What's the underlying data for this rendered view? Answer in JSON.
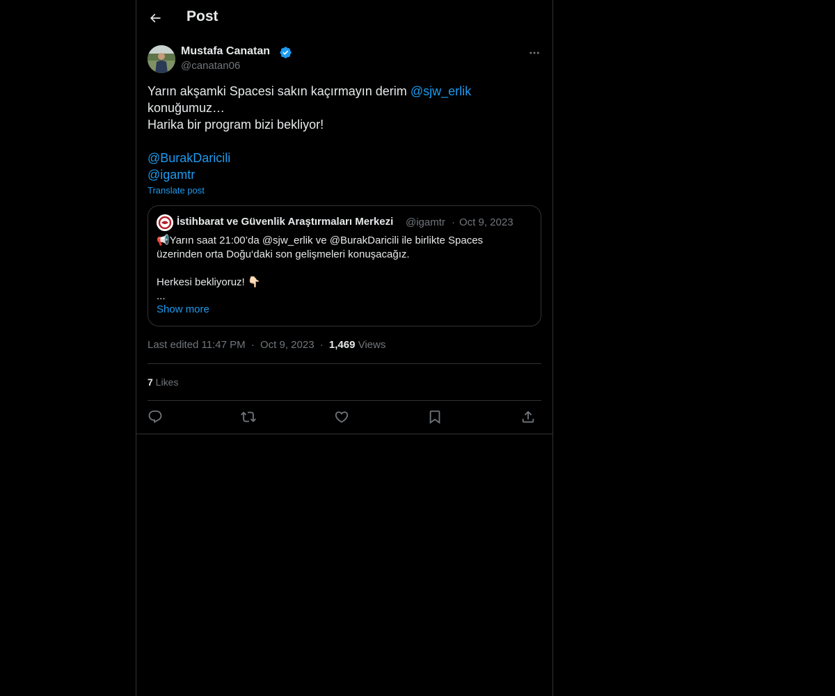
{
  "header": {
    "title": "Post",
    "back_icon": "arrow-left-icon"
  },
  "post": {
    "author": {
      "name": "Mustafa Canatan",
      "handle": "@canatan06",
      "verified_icon": "verified-badge-icon"
    },
    "more_icon": "more-horizontal-icon",
    "text": {
      "line1_prefix": "Yarın akşamki Spacesi sakın kaçırmayın derim ",
      "line1_mention": "@sjw_erlik",
      "line2": "konuğumuz…",
      "line3": "Harika bir program bizi bekliyor!",
      "mention2": "@BurakDaricili",
      "mention3": "@igamtr"
    },
    "translate_label": "Translate post",
    "quote": {
      "name": "İstihbarat ve Güvenlik Araştırmaları Merkezi",
      "handle": "@igamtr",
      "separator": "·",
      "date": "Oct 9, 2023",
      "line1": "📢Yarın saat 21:00’da @sjw_erlik ve @BurakDaricili  ile birlikte Spaces",
      "line2": "üzerinden orta Doğu‘daki son gelişmeleri konuşacağız.",
      "line3": "Herkesi bekliyoruz! 👇🏻",
      "ellipsis": "...",
      "show_more": "Show more"
    },
    "meta": {
      "edited": "Last edited 11:47 PM",
      "sep1": "·",
      "date": "Oct 9, 2023",
      "sep2": "·",
      "views_count": "1,469",
      "views_label": " Views"
    },
    "likes": {
      "count": "7",
      "label": " Likes"
    },
    "actions": [
      {
        "name": "reply",
        "icon": "reply-icon"
      },
      {
        "name": "repost",
        "icon": "repost-icon"
      },
      {
        "name": "like",
        "icon": "heart-icon"
      },
      {
        "name": "bookmark",
        "icon": "bookmark-icon"
      },
      {
        "name": "share",
        "icon": "share-icon"
      }
    ]
  },
  "colors": {
    "background": "#000000",
    "text": "#e7e9ea",
    "muted": "#71767b",
    "accent": "#1d9bf0",
    "border": "#2f3336"
  }
}
